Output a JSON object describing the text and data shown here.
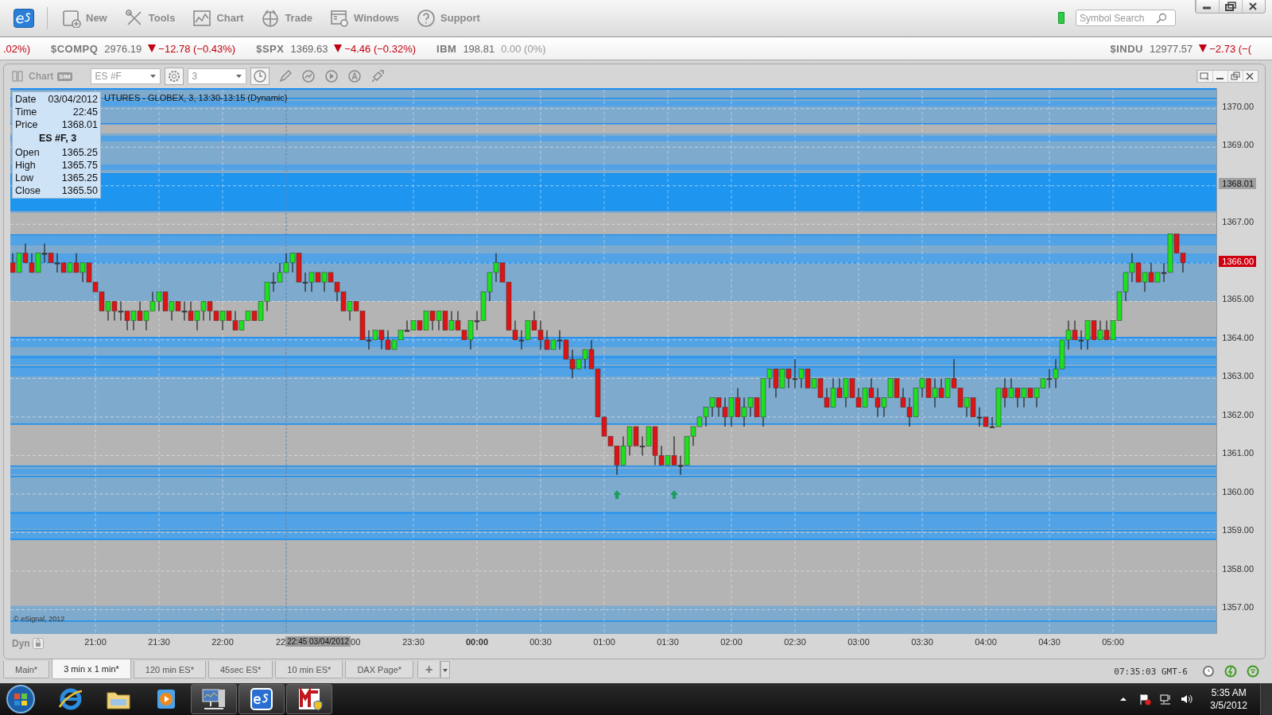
{
  "toolbar": {
    "items": [
      {
        "kind": "new",
        "label": "New"
      },
      {
        "kind": "tools",
        "label": "Tools"
      },
      {
        "kind": "chart",
        "label": "Chart"
      },
      {
        "kind": "trade",
        "label": "Trade"
      },
      {
        "kind": "windows",
        "label": "Windows"
      },
      {
        "kind": "support",
        "label": "Support"
      }
    ],
    "search": {
      "placeholder": "Symbol Search"
    }
  },
  "ticker": [
    {
      "change": ".02%)",
      "down": true
    },
    {
      "symbol": "$COMPQ",
      "price": "2976.19",
      "change": "−12.78 (−0.43%)",
      "down": true
    },
    {
      "symbol": "$SPX",
      "price": "1369.63",
      "change": "−4.46 (−0.32%)",
      "down": true
    },
    {
      "symbol": "IBM",
      "price": "198.81",
      "change": "0.00 (0%)",
      "down": false
    }
  ],
  "ticker_right": {
    "symbol": "$INDU",
    "price": "12977.57",
    "change": "−2.73 (−(",
    "down": true
  },
  "chart": {
    "title": "Chart",
    "badge": "SIM",
    "symbol": "ES #F",
    "interval": "3",
    "caption": "UTURES - GLOBEX, 3, 13:30-13:15 (Dynamic)",
    "info": {
      "rows": [
        {
          "label": "Date",
          "value": "03/04/2012"
        },
        {
          "label": "Time",
          "value": "22:45"
        },
        {
          "label": "Price",
          "value": "1368.01"
        }
      ],
      "heading": "ES #F, 3",
      "ohlc": [
        {
          "label": "Open",
          "value": "1365.25"
        },
        {
          "label": "High",
          "value": "1365.75"
        },
        {
          "label": "Low",
          "value": "1365.25"
        },
        {
          "label": "Close",
          "value": "1365.50"
        }
      ]
    },
    "flags": [
      {
        "kind": "cursor",
        "label": "1368.01"
      },
      {
        "kind": "last",
        "label": "1366.00"
      }
    ],
    "xaxis_partial": [
      {
        "kind": "start",
        "label": "22"
      },
      {
        "kind": "end",
        "label": "00"
      }
    ],
    "cursor_label": "22:45 03/04/2012",
    "copyright": "© eSignal, 2012",
    "dyn": "Dyn",
    "chart_data": {
      "type": "candlestick",
      "ylim": [
        1356.37,
        1370.49
      ],
      "grid": true,
      "yticks": [
        {
          "value": 1370,
          "label": "1370.00"
        },
        {
          "value": 1369,
          "label": "1369.00"
        },
        {
          "value": 1367,
          "label": "1367.00"
        },
        {
          "value": 1365,
          "label": "1365.00"
        },
        {
          "value": 1364,
          "label": "1364.00"
        },
        {
          "value": 1363,
          "label": "1363.00"
        },
        {
          "value": 1362,
          "label": "1362.00"
        },
        {
          "value": 1361,
          "label": "1361.00"
        },
        {
          "value": 1360,
          "label": "1360.00"
        },
        {
          "value": 1359,
          "label": "1359.00"
        },
        {
          "value": 1358,
          "label": "1358.00"
        },
        {
          "value": 1357,
          "label": "1357.00"
        }
      ],
      "categories": [
        null,
        null,
        null,
        null,
        null,
        null,
        null,
        null,
        null,
        null,
        null,
        null,
        null,
        "21:00",
        null,
        null,
        null,
        null,
        null,
        null,
        null,
        null,
        null,
        "21:30",
        null,
        null,
        null,
        null,
        null,
        null,
        null,
        null,
        null,
        "22:00",
        null,
        null,
        null,
        null,
        null,
        null,
        null,
        null,
        null,
        null,
        null,
        null,
        null,
        null,
        null,
        null,
        null,
        null,
        null,
        null,
        null,
        null,
        null,
        null,
        null,
        null,
        null,
        null,
        null,
        "23:30",
        null,
        null,
        null,
        null,
        null,
        null,
        null,
        null,
        null,
        "00:00",
        null,
        null,
        null,
        null,
        null,
        null,
        null,
        null,
        null,
        "00:30",
        null,
        null,
        null,
        null,
        null,
        null,
        null,
        null,
        null,
        "01:00",
        null,
        null,
        null,
        null,
        null,
        null,
        null,
        null,
        null,
        "01:30",
        null,
        null,
        null,
        null,
        null,
        null,
        null,
        null,
        null,
        "02:00",
        null,
        null,
        null,
        null,
        null,
        null,
        null,
        null,
        null,
        "02:30",
        null,
        null,
        null,
        null,
        null,
        null,
        null,
        null,
        null,
        "03:00",
        null,
        null,
        null,
        null,
        null,
        null,
        null,
        null,
        null,
        "03:30",
        null,
        null,
        null,
        null,
        null,
        null,
        null,
        null,
        null,
        "04:00",
        null,
        null,
        null,
        null,
        null,
        null,
        null,
        null,
        null,
        "04:30",
        null,
        null,
        null,
        null,
        null,
        null,
        null,
        null,
        null,
        "05:00",
        null,
        null,
        null,
        null,
        null,
        null,
        null,
        null,
        null,
        null,
        null
      ],
      "ohlc": [
        [
          1366,
          1366.25,
          1365.75,
          1365.75
        ],
        [
          1365.75,
          1366.25,
          1365.75,
          1366.25
        ],
        [
          1366.25,
          1366.5,
          1366,
          1366
        ],
        [
          1366,
          1366.25,
          1365.75,
          1365.75
        ],
        [
          1365.75,
          1366.25,
          1365.75,
          1366.25
        ],
        [
          1366.25,
          1366.5,
          1366,
          1366.25
        ],
        [
          1366.25,
          1366.25,
          1366,
          1366
        ],
        [
          1366,
          1366.25,
          1365.75,
          1366
        ],
        [
          1366,
          1366,
          1365.75,
          1365.75
        ],
        [
          1365.75,
          1366,
          1365.75,
          1366
        ],
        [
          1366,
          1366.25,
          1365.75,
          1365.75
        ],
        [
          1365.75,
          1366,
          1365.5,
          1366
        ],
        [
          1366,
          1366,
          1365.5,
          1365.5
        ],
        [
          1365.5,
          1365.5,
          1365.25,
          1365.25
        ],
        [
          1365.25,
          1365.25,
          1364.75,
          1364.75
        ],
        [
          1364.75,
          1365,
          1364.5,
          1365
        ],
        [
          1365,
          1365,
          1364.5,
          1364.75
        ],
        [
          1364.75,
          1365,
          1364.5,
          1364.75
        ],
        [
          1364.75,
          1364.75,
          1364.25,
          1364.5
        ],
        [
          1364.5,
          1364.75,
          1364.25,
          1364.75
        ],
        [
          1364.75,
          1365,
          1364.5,
          1364.5
        ],
        [
          1364.5,
          1364.75,
          1364.25,
          1364.75
        ],
        [
          1364.75,
          1365.25,
          1364.75,
          1365
        ],
        [
          1365,
          1365.25,
          1364.75,
          1365.25
        ],
        [
          1365.25,
          1365.25,
          1364.75,
          1364.75
        ],
        [
          1364.75,
          1365,
          1364.5,
          1365
        ],
        [
          1365,
          1365,
          1364.75,
          1364.75
        ],
        [
          1364.75,
          1365,
          1364.5,
          1364.75
        ],
        [
          1364.75,
          1365,
          1364.5,
          1364.5
        ],
        [
          1364.5,
          1364.75,
          1364.25,
          1364.75
        ],
        [
          1364.75,
          1365,
          1364.5,
          1365
        ],
        [
          1365,
          1365,
          1364.5,
          1364.75
        ],
        [
          1364.75,
          1364.75,
          1364.5,
          1364.5
        ],
        [
          1364.5,
          1364.75,
          1364.25,
          1364.75
        ],
        [
          1364.75,
          1364.75,
          1364.5,
          1364.5
        ],
        [
          1364.5,
          1364.75,
          1364.25,
          1364.25
        ],
        [
          1364.25,
          1364.5,
          1364.25,
          1364.5
        ],
        [
          1364.5,
          1364.75,
          1364.5,
          1364.75
        ],
        [
          1364.75,
          1364.75,
          1364.5,
          1364.5
        ],
        [
          1364.5,
          1365,
          1364.5,
          1365
        ],
        [
          1365,
          1365.5,
          1364.75,
          1365.5
        ],
        [
          1365.5,
          1365.75,
          1365.25,
          1365.5
        ],
        [
          1365.5,
          1366,
          1365.5,
          1365.75
        ],
        [
          1365.75,
          1366.25,
          1365.75,
          1366
        ],
        [
          1366,
          1366.25,
          1365.75,
          1366.25
        ],
        [
          1366.25,
          1366.25,
          1365.5,
          1365.5
        ],
        [
          1365.5,
          1365.75,
          1365.25,
          1365.5
        ],
        [
          1365.5,
          1365.75,
          1365.25,
          1365.75
        ],
        [
          1365.75,
          1365.75,
          1365.5,
          1365.5
        ],
        [
          1365.5,
          1365.75,
          1365.25,
          1365.75
        ],
        [
          1365.75,
          1365.75,
          1365.5,
          1365.5
        ],
        [
          1365.5,
          1365.5,
          1365,
          1365.25
        ],
        [
          1365.25,
          1365.25,
          1364.75,
          1364.75
        ],
        [
          1364.75,
          1365,
          1364.5,
          1365
        ],
        [
          1365,
          1365,
          1364.75,
          1364.75
        ],
        [
          1364.75,
          1364.75,
          1364,
          1364
        ],
        [
          1364,
          1364.25,
          1363.75,
          1364
        ],
        [
          1364,
          1364.25,
          1364,
          1364.25
        ],
        [
          1364.25,
          1364.25,
          1363.75,
          1364
        ],
        [
          1364,
          1364.25,
          1363.75,
          1363.75
        ],
        [
          1363.75,
          1364,
          1363.75,
          1364
        ],
        [
          1364,
          1364.25,
          1364,
          1364.25
        ],
        [
          1364.25,
          1364.5,
          1364.25,
          1364.25
        ],
        [
          1364.25,
          1364.5,
          1364.25,
          1364.5
        ],
        [
          1364.5,
          1364.5,
          1364.25,
          1364.25
        ],
        [
          1364.25,
          1364.75,
          1364.25,
          1364.75
        ],
        [
          1364.75,
          1364.75,
          1364.25,
          1364.5
        ],
        [
          1364.5,
          1364.75,
          1364.25,
          1364.75
        ],
        [
          1364.75,
          1364.75,
          1364.25,
          1364.25
        ],
        [
          1364.25,
          1364.75,
          1364.25,
          1364.5
        ],
        [
          1364.5,
          1364.75,
          1364.25,
          1364.25
        ],
        [
          1364.25,
          1364.25,
          1364,
          1364
        ],
        [
          1364,
          1364.5,
          1363.75,
          1364.5
        ],
        [
          1364.5,
          1364.75,
          1364.25,
          1364.5
        ],
        [
          1364.5,
          1365.25,
          1364.5,
          1365.25
        ],
        [
          1365.25,
          1365.75,
          1365,
          1365.75
        ],
        [
          1365.75,
          1366.25,
          1365.5,
          1366
        ],
        [
          1366,
          1366,
          1365.5,
          1365.5
        ],
        [
          1365.5,
          1365.5,
          1364.25,
          1364.25
        ],
        [
          1364.25,
          1364.5,
          1364,
          1364
        ],
        [
          1364,
          1364.25,
          1363.75,
          1364
        ],
        [
          1364,
          1364.5,
          1364,
          1364.5
        ],
        [
          1364.5,
          1364.75,
          1364.25,
          1364.25
        ],
        [
          1364.25,
          1364.5,
          1363.75,
          1364
        ],
        [
          1364,
          1364.25,
          1363.75,
          1363.75
        ],
        [
          1363.75,
          1364,
          1363.75,
          1364
        ],
        [
          1364,
          1364.25,
          1363.75,
          1364
        ],
        [
          1364,
          1364,
          1363.5,
          1363.5
        ],
        [
          1363.5,
          1363.75,
          1363,
          1363.25
        ],
        [
          1363.25,
          1363.5,
          1363.25,
          1363.5
        ],
        [
          1363.5,
          1363.75,
          1363.25,
          1363.75
        ],
        [
          1363.75,
          1364,
          1363.25,
          1363.25
        ],
        [
          1363.25,
          1363.25,
          1362,
          1362
        ],
        [
          1362,
          1362,
          1361.5,
          1361.5
        ],
        [
          1361.5,
          1361.5,
          1361.25,
          1361.25
        ],
        [
          1361.25,
          1361.25,
          1360.5,
          1360.75
        ],
        [
          1360.75,
          1361.5,
          1360.75,
          1361.25
        ],
        [
          1361.25,
          1361.75,
          1361,
          1361.75
        ],
        [
          1361.75,
          1361.75,
          1361.25,
          1361.25
        ],
        [
          1361.25,
          1361.5,
          1361,
          1361.25
        ],
        [
          1361.25,
          1361.75,
          1361.25,
          1361.75
        ],
        [
          1361.75,
          1361.75,
          1360.75,
          1361
        ],
        [
          1361,
          1361.25,
          1360.75,
          1360.75
        ],
        [
          1360.75,
          1361,
          1360.75,
          1361
        ],
        [
          1361,
          1361.5,
          1360.75,
          1360.75
        ],
        [
          1360.75,
          1361,
          1360.5,
          1360.75
        ],
        [
          1360.75,
          1361.5,
          1360.75,
          1361.5
        ],
        [
          1361.5,
          1361.75,
          1361.25,
          1361.75
        ],
        [
          1361.75,
          1362,
          1361.75,
          1362
        ],
        [
          1362,
          1362.25,
          1361.75,
          1362.25
        ],
        [
          1362.25,
          1362.5,
          1362,
          1362.5
        ],
        [
          1362.5,
          1362.5,
          1362,
          1362.25
        ],
        [
          1362.25,
          1362.5,
          1361.75,
          1362
        ],
        [
          1362,
          1362.5,
          1361.75,
          1362.5
        ],
        [
          1362.5,
          1362.75,
          1362,
          1362
        ],
        [
          1362,
          1362.5,
          1361.75,
          1362.25
        ],
        [
          1362.25,
          1362.5,
          1362,
          1362.5
        ],
        [
          1362.5,
          1362.5,
          1362,
          1362
        ],
        [
          1362,
          1363,
          1361.75,
          1363
        ],
        [
          1363,
          1363.25,
          1362.75,
          1363.25
        ],
        [
          1363.25,
          1363.25,
          1362.5,
          1362.75
        ],
        [
          1362.75,
          1363.25,
          1362.75,
          1363.25
        ],
        [
          1363.25,
          1363.25,
          1362.75,
          1363
        ],
        [
          1363,
          1363.5,
          1362.75,
          1363
        ],
        [
          1363,
          1363.25,
          1362.75,
          1363.25
        ],
        [
          1363.25,
          1363.25,
          1362.75,
          1362.75
        ],
        [
          1362.75,
          1363,
          1362.75,
          1363
        ],
        [
          1363,
          1363,
          1362.5,
          1362.5
        ],
        [
          1362.5,
          1362.75,
          1362.25,
          1362.25
        ],
        [
          1362.25,
          1363,
          1362.25,
          1362.75
        ],
        [
          1362.75,
          1363,
          1362.5,
          1362.5
        ],
        [
          1362.5,
          1363,
          1362.25,
          1363
        ],
        [
          1363,
          1363,
          1362.5,
          1362.5
        ],
        [
          1362.5,
          1362.75,
          1362.25,
          1362.25
        ],
        [
          1362.25,
          1362.75,
          1362.25,
          1362.75
        ],
        [
          1362.75,
          1363,
          1362.5,
          1362.5
        ],
        [
          1362.5,
          1362.75,
          1362,
          1362.25
        ],
        [
          1362.25,
          1362.5,
          1362,
          1362.5
        ],
        [
          1362.5,
          1363,
          1362.5,
          1363
        ],
        [
          1363,
          1363,
          1362.5,
          1362.5
        ],
        [
          1362.5,
          1362.75,
          1362.25,
          1362.25
        ],
        [
          1362.25,
          1362.5,
          1361.75,
          1362
        ],
        [
          1362,
          1362.75,
          1362,
          1362.75
        ],
        [
          1362.75,
          1363,
          1362.5,
          1363
        ],
        [
          1363,
          1363,
          1362.5,
          1362.5
        ],
        [
          1362.5,
          1363,
          1362.25,
          1362.75
        ],
        [
          1362.75,
          1363,
          1362.5,
          1362.5
        ],
        [
          1362.5,
          1363,
          1362.5,
          1363
        ],
        [
          1363,
          1363.5,
          1362.75,
          1362.75
        ],
        [
          1362.75,
          1362.75,
          1362.25,
          1362.25
        ],
        [
          1362.25,
          1362.5,
          1362,
          1362.5
        ],
        [
          1362.5,
          1362.5,
          1362,
          1362
        ],
        [
          1362,
          1362.25,
          1361.75,
          1362
        ],
        [
          1362,
          1362,
          1361.75,
          1361.75
        ],
        [
          1361.75,
          1362,
          1361.75,
          1361.75
        ],
        [
          1361.75,
          1362.75,
          1361.75,
          1362.75
        ],
        [
          1362.75,
          1363,
          1362.25,
          1362.5
        ],
        [
          1362.5,
          1363,
          1362.5,
          1362.75
        ],
        [
          1362.75,
          1362.75,
          1362.25,
          1362.5
        ],
        [
          1362.5,
          1362.75,
          1362.25,
          1362.75
        ],
        [
          1362.75,
          1362.75,
          1362.5,
          1362.5
        ],
        [
          1362.5,
          1362.75,
          1362.25,
          1362.75
        ],
        [
          1362.75,
          1363,
          1362.75,
          1363
        ],
        [
          1363,
          1363.25,
          1362.75,
          1363
        ],
        [
          1363,
          1363.5,
          1362.75,
          1363.25
        ],
        [
          1363.25,
          1364,
          1363.25,
          1364
        ],
        [
          1364,
          1364.5,
          1363.75,
          1364.25
        ],
        [
          1364.25,
          1364.5,
          1364,
          1364
        ],
        [
          1364,
          1364.25,
          1363.75,
          1364
        ],
        [
          1364,
          1364.5,
          1363.75,
          1364.5
        ],
        [
          1364.5,
          1364.5,
          1364,
          1364
        ],
        [
          1364,
          1364.5,
          1364,
          1364.25
        ],
        [
          1364.25,
          1364.5,
          1364,
          1364
        ],
        [
          1364,
          1364.5,
          1364,
          1364.5
        ],
        [
          1364.5,
          1365.25,
          1364.5,
          1365.25
        ],
        [
          1365.25,
          1365.75,
          1365,
          1365.75
        ],
        [
          1365.75,
          1366.25,
          1365.5,
          1366
        ],
        [
          1366,
          1366,
          1365.5,
          1365.5
        ],
        [
          1365.5,
          1365.75,
          1365.25,
          1365.75
        ],
        [
          1365.75,
          1366,
          1365.5,
          1365.5
        ],
        [
          1365.5,
          1365.75,
          1365.5,
          1365.75
        ],
        [
          1365.75,
          1366,
          1365.5,
          1365.75
        ],
        [
          1365.75,
          1366.75,
          1365.75,
          1366.75
        ],
        [
          1366.75,
          1366.75,
          1366.25,
          1366.25
        ],
        [
          1366.25,
          1366.25,
          1365.75,
          1366
        ]
      ]
    }
  },
  "tabs": [
    {
      "label": "Main*",
      "selected": false
    },
    {
      "label": "3 min x 1 min*",
      "selected": true
    },
    {
      "label": "120 min ES*",
      "selected": false
    },
    {
      "label": "45sec ES*",
      "selected": false
    },
    {
      "label": "10 min ES*",
      "selected": false
    },
    {
      "label": "DAX Page*",
      "selected": false
    }
  ],
  "add_tab": "+",
  "status": {
    "time": "07:35:03 GMT-6"
  },
  "taskbar": {
    "apps": [
      {
        "kind": "ie"
      },
      {
        "kind": "folder"
      },
      {
        "kind": "media"
      },
      {
        "kind": "network"
      },
      {
        "kind": "es"
      },
      {
        "kind": "m"
      }
    ],
    "clock": {
      "time": "5:35 AM",
      "date": "3/5/2012"
    }
  }
}
